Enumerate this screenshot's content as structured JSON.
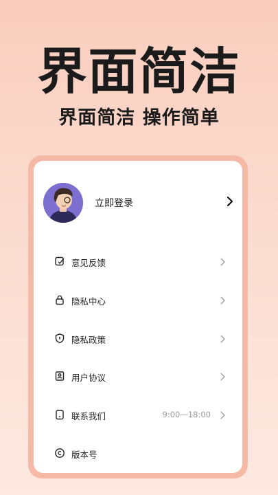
{
  "hero": {
    "title": "界面简洁",
    "subtitle": "界面简洁 操作简单"
  },
  "profile": {
    "login_label": "立即登录",
    "avatar_icon": "person-avatar"
  },
  "menu": {
    "items": [
      {
        "label": "意见反馈",
        "icon": "feedback-icon",
        "value": ""
      },
      {
        "label": "隐私中心",
        "icon": "lock-icon",
        "value": ""
      },
      {
        "label": "隐私政策",
        "icon": "shield-icon",
        "value": ""
      },
      {
        "label": "用户协议",
        "icon": "user-agreement-icon",
        "value": ""
      },
      {
        "label": "联系我们",
        "icon": "phone-icon",
        "value": "9:00—18:00"
      },
      {
        "label": "版本号",
        "icon": "copyright-icon",
        "value": ""
      }
    ]
  },
  "colors": {
    "background_top": "#f9cdbd",
    "frame": "#f6b9a6",
    "avatar_bg": "#7d6fcf"
  }
}
